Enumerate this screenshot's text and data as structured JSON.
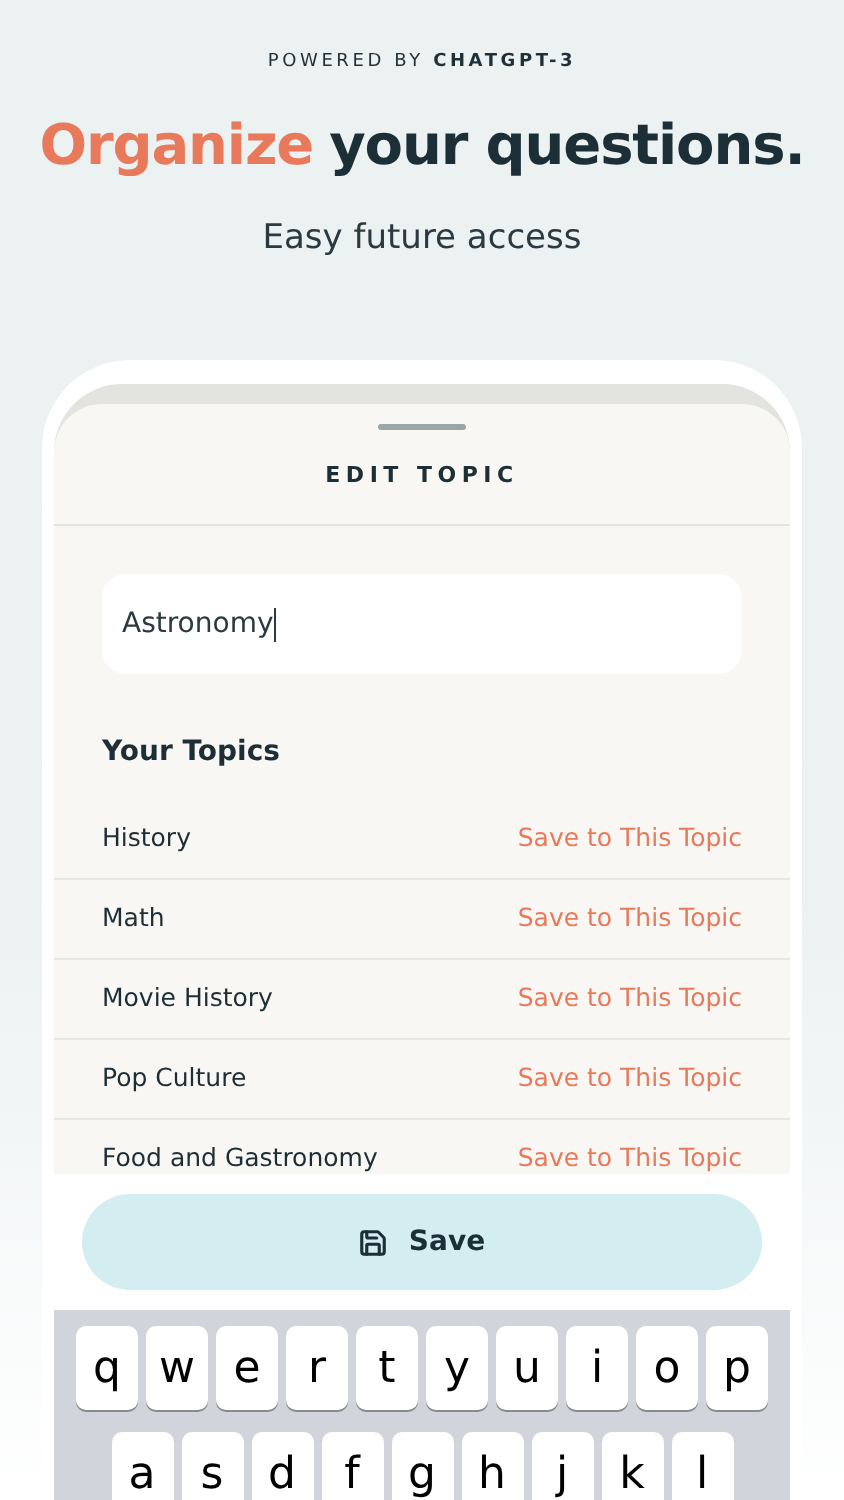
{
  "header": {
    "eyebrow": "POWERED BY **CHATGPT-3**",
    "headline_accent": "Organize",
    "headline_rest": "your questions.",
    "subtitle": "Easy future access"
  },
  "sheet": {
    "title": "EDIT TOPIC",
    "topic_field": {
      "value": "Astronomy"
    },
    "section_title": "Your Topics",
    "topics": [
      {
        "name": "History",
        "action": "Save to This Topic"
      },
      {
        "name": "Math",
        "action": "Save to This Topic"
      },
      {
        "name": "Movie History",
        "action": "Save to This Topic"
      },
      {
        "name": "Pop Culture",
        "action": "Save to This Topic"
      },
      {
        "name": "Food and Gastronomy",
        "action": "Save to This Topic"
      }
    ],
    "save_button": "Save"
  },
  "keyboard": {
    "rows": [
      [
        "q",
        "w",
        "e",
        "r",
        "t",
        "y",
        "u",
        "i",
        "o",
        "p"
      ],
      [
        "a",
        "s",
        "d",
        "f",
        "g",
        "h",
        "j",
        "k",
        "l"
      ]
    ]
  }
}
